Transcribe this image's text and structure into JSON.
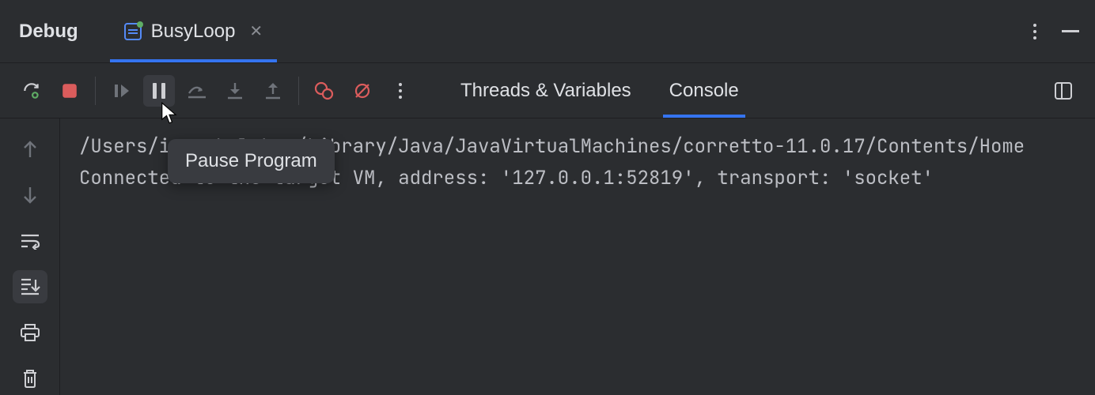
{
  "header": {
    "title": "Debug",
    "tab": {
      "label": "BusyLoop"
    }
  },
  "toolbar": {
    "tabs": {
      "threads": "Threads & Variables",
      "console": "Console"
    }
  },
  "tooltip": {
    "text": "Pause Program"
  },
  "console": {
    "line1": "/Users/igor kulakov/Library/Java/JavaVirtualMachines/corretto-11.0.17/Contents/Home",
    "line2": "Connected to the target VM, address: '127.0.0.1:52819', transport: 'socket'"
  }
}
